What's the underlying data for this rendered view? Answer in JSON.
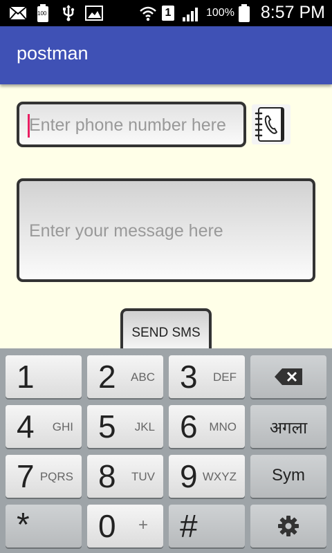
{
  "status_bar": {
    "sim_slot": "1",
    "battery_level_small": "100",
    "battery_percent": "100%",
    "time": "8:57 PM",
    "icons": [
      "mail-icon",
      "battery-saver-icon",
      "usb-icon",
      "image-icon",
      "wifi-icon",
      "sim-icon",
      "signal-icon",
      "battery-icon"
    ]
  },
  "app_bar": {
    "title": "postman"
  },
  "form": {
    "phone_placeholder": "Enter phone number here",
    "message_placeholder": "Enter your message here",
    "contacts_icon": "contacts-book-icon",
    "send_label": "SEND SMS"
  },
  "keyboard": {
    "rows": [
      [
        {
          "main": "1",
          "sub": ""
        },
        {
          "main": "2",
          "sub": "ABC"
        },
        {
          "main": "3",
          "sub": "DEF"
        },
        {
          "main": "",
          "sub": "",
          "icon": "backspace-icon"
        }
      ],
      [
        {
          "main": "4",
          "sub": "GHI"
        },
        {
          "main": "5",
          "sub": "JKL"
        },
        {
          "main": "6",
          "sub": "MNO"
        },
        {
          "main": "अगला",
          "sub": ""
        }
      ],
      [
        {
          "main": "7",
          "sub": "PQRS"
        },
        {
          "main": "8",
          "sub": "TUV"
        },
        {
          "main": "9",
          "sub": "WXYZ"
        },
        {
          "main": "Sym",
          "sub": ""
        }
      ],
      [
        {
          "main": "*",
          "sub": ""
        },
        {
          "main": "0",
          "sub": "+"
        },
        {
          "main": "#",
          "sub": ""
        },
        {
          "main": "",
          "sub": "",
          "icon": "settings-gear-icon"
        }
      ]
    ]
  },
  "colors": {
    "app_bar": "#3f51b5",
    "content_bg": "#ffffe8",
    "cursor": "#e91e63",
    "keyboard_bg": "#9ea4a8"
  }
}
